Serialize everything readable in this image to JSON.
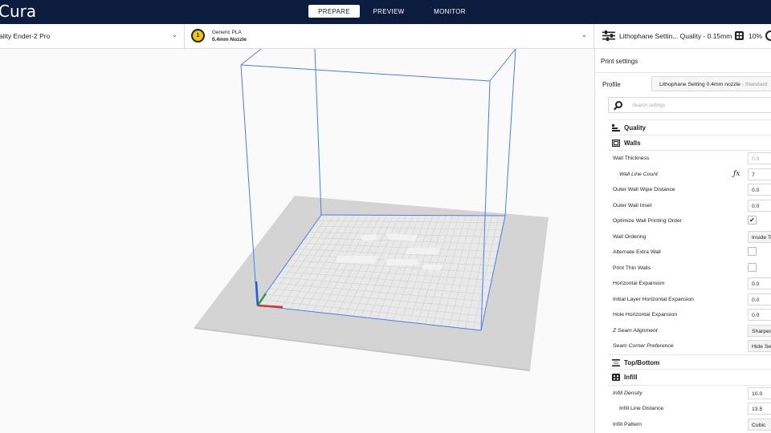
{
  "app": {
    "logo": "Cura"
  },
  "stages": [
    {
      "label": "PREPARE",
      "active": true
    },
    {
      "label": "PREVIEW",
      "active": false
    },
    {
      "label": "MONITOR",
      "active": false
    }
  ],
  "printer": {
    "name": "ality Ender-2 Pro"
  },
  "material": {
    "extruder": "1",
    "name": "Generic PLA",
    "nozzle": "0.4mm Nozzle"
  },
  "quality_bar": {
    "profile": "Lithophane Settin... Quality - 0.15mm",
    "infill": "10%"
  },
  "panel": {
    "title": "Print settings",
    "profile_label": "Profile",
    "profile_value": "Lithophane Setting 0.4mm nozzle",
    "profile_suffix": " - Standard",
    "search_placeholder": "Search settings",
    "categories": {
      "quality": "Quality",
      "walls": "Walls",
      "topbottom": "Top/Bottom",
      "infill": "Infill"
    },
    "walls_settings": [
      {
        "label": "Wall Thickness",
        "value": "0.9"
      },
      {
        "label": "Wall Line Count",
        "value": "7"
      },
      {
        "label": "Outer Wall Wipe Distance",
        "value": "0.0"
      },
      {
        "label": "Outer Wall Inset",
        "value": "0.0"
      },
      {
        "label": "Optimize Wall Printing Order",
        "value": "✔"
      },
      {
        "label": "Wall Ordering",
        "value": "Inside To Outside"
      },
      {
        "label": "Alternate Extra Wall",
        "value": ""
      },
      {
        "label": "Print Thin Walls",
        "value": ""
      },
      {
        "label": "Horizontal Expansion",
        "value": "0.0"
      },
      {
        "label": "Initial Layer Horizontal Expansion",
        "value": "0.0"
      },
      {
        "label": "Hole Horizontal Expansion",
        "value": "0.0"
      },
      {
        "label": "Z Seam Alignment",
        "value": "Sharpest Corner"
      },
      {
        "label": "Seam Corner Preference",
        "value": "Hide Seam"
      }
    ],
    "infill_settings": [
      {
        "label": "Infill Density",
        "value": "10.0"
      },
      {
        "label": "Infill Line Distance",
        "value": "13.5"
      },
      {
        "label": "Infill Pattern",
        "value": "Cubic"
      }
    ]
  },
  "colors": {
    "topbar": "#0c1c3e",
    "build_volume": "#4a7ee8",
    "axis_x": "#d9342b",
    "axis_y": "#3a9c3a",
    "axis_z": "#2a5bd7"
  },
  "icons": {
    "quality_bar": "sliders-icon",
    "infill": "infill-icon",
    "support": "support-icon",
    "search": "search-icon"
  }
}
